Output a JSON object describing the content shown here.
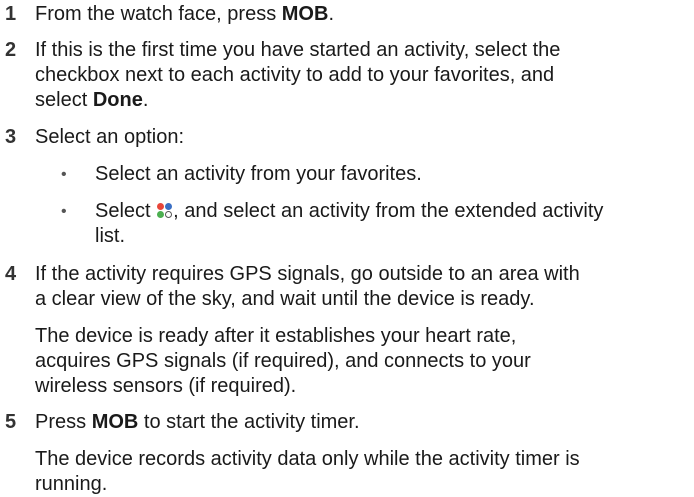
{
  "steps": [
    {
      "number": "1",
      "text_before": "From the watch face, press ",
      "button": "MOB",
      "text_after": "."
    },
    {
      "number": "2",
      "line1": "If this is the first time you have started an activity, select the",
      "line2": "checkbox next to each activity to add to your favorites, and",
      "line3_before": "select ",
      "line3_button": "Done",
      "line3_after": "."
    },
    {
      "number": "3",
      "text": "Select an option:",
      "bullets": [
        {
          "text": "Select an activity from your favorites."
        },
        {
          "text_before": "Select ",
          "icon": "apps-icon",
          "text_after": ", and select an activity from the extended activity",
          "line2": "list."
        }
      ]
    },
    {
      "number": "4",
      "line1": "If the activity requires GPS signals, go outside to an area with",
      "line2": "a clear view of the sky, and wait until the device is ready.",
      "para_line1": "The device is ready after it establishes your heart rate,",
      "para_line2": "acquires GPS signals (if required), and connects to your",
      "para_line3": "wireless sensors (if required)."
    },
    {
      "number": "5",
      "text_before": "Press ",
      "button": "MOB",
      "text_after": " to start the activity timer.",
      "para_line1": "The device records activity data only while the activity timer is",
      "para_line2": "running."
    }
  ],
  "bullet_char": "•",
  "colors": {
    "text": "#1a1a1a",
    "icon_red": "#e8463a",
    "icon_blue": "#3a6fc4",
    "icon_green": "#4caf50"
  }
}
